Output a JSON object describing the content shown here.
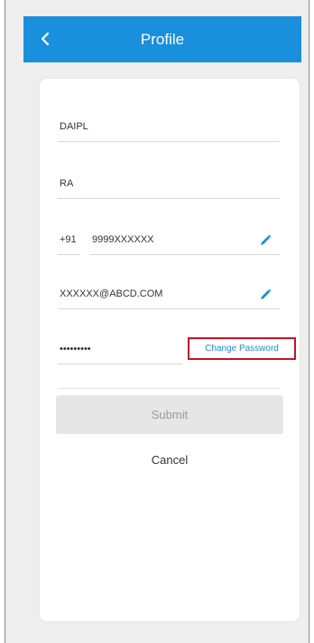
{
  "header": {
    "title": "Profile",
    "back_icon": "chevron-left-icon",
    "color": "#1a8fdc"
  },
  "form": {
    "first_name": "DAIPL",
    "last_name": "RA",
    "country_code": "+91",
    "phone": "9999XXXXXX",
    "email": "XXXXXX@ABCD.COM",
    "password_mask": "•••••••••",
    "change_password_label": "Change Password",
    "submit_label": "Submit",
    "cancel_label": "Cancel"
  },
  "colors": {
    "accent": "#1a8fdc",
    "highlight_border": "#c8102e"
  }
}
